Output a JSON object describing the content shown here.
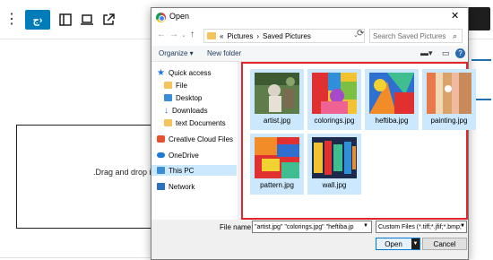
{
  "editor": {
    "toolbar": {
      "more_icon": "kebab-icon",
      "primary_button_label": "ج›",
      "sidebar_icon": "panel-icon",
      "preview_icon": "laptop-icon",
      "external_icon": "external-link-icon"
    },
    "upload_text": ".Drag and drop in"
  },
  "dialog": {
    "title": "Open",
    "close_label": "✕",
    "address": {
      "prefix": "«",
      "segments": [
        "Pictures",
        "›",
        "Saved Pictures"
      ]
    },
    "search_placeholder": "Search Saved Pictures",
    "toolbar": {
      "organize_label": "Organize ▾",
      "new_folder_label": "New folder"
    },
    "nav_items": [
      {
        "label": "Quick access",
        "icon": "star-icon"
      },
      {
        "label": "File",
        "icon": "folder-icon"
      },
      {
        "label": "Desktop",
        "icon": "desktop-icon"
      },
      {
        "label": "Downloads",
        "icon": "download-icon"
      },
      {
        "label": "text Documents",
        "icon": "folder-icon"
      },
      {
        "label": "Creative Cloud Files",
        "icon": "creative-cloud-icon"
      },
      {
        "label": "OneDrive",
        "icon": "cloud-icon"
      },
      {
        "label": "This PC",
        "icon": "pc-icon"
      },
      {
        "label": "Network",
        "icon": "network-icon"
      }
    ],
    "files": [
      {
        "name": "artist.jpg"
      },
      {
        "name": "colorings.jpg"
      },
      {
        "name": "heftiba.jpg"
      },
      {
        "name": "painting.jpg"
      },
      {
        "name": "pattern.jpg"
      },
      {
        "name": "wall.jpg"
      }
    ],
    "file_name_label": "File name:",
    "file_name_value": "\"artist.jpg\" \"colorings.jpg\" \"heftiba.jp",
    "file_type_value": "Custom Files (*.tiff;*.jfif;*.bmp;*",
    "open_label": "Open",
    "cancel_label": "Cancel"
  },
  "colors": {
    "accent": "#007cba",
    "selection": "#cce8ff",
    "highlight_border": "#e1262d"
  }
}
